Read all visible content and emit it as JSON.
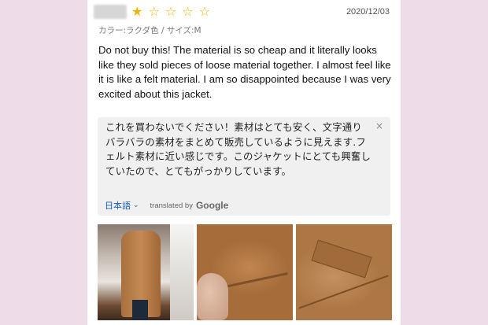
{
  "review": {
    "rating": 1,
    "rating_max": 5,
    "stars": [
      "★",
      "☆",
      "☆",
      "☆",
      "☆"
    ],
    "date": "2020/12/03",
    "variant": "カラー:ラクダ色 / サイズ:M",
    "body": "Do not buy this! The material is so cheap and it literally looks like they sold pieces of loose material together. I almost feel like it is like a felt material. I am so disappointed because I was very excited about this jacket."
  },
  "translation": {
    "text": "これを買わないでください！素材はとても安く、文字通りバラバラの素材をまとめて販売しているように見えます.フェルト素材に近い感じです。このジャケットにとても興奮していたので、とてもがっかりしています。",
    "close_label": "×",
    "language": "日本語",
    "chevron": "⌄",
    "translated_by": "translated by",
    "provider": "Google"
  },
  "colors": {
    "background": "#eedde8",
    "star": "#f0b500",
    "link": "#1a5fb4",
    "translation_bg": "#f0f0f0"
  },
  "photos": [
    {
      "subject": "person-wearing-camel-coat"
    },
    {
      "subject": "coat-fabric-closeup-hand"
    },
    {
      "subject": "coat-pocket-closeup"
    }
  ]
}
